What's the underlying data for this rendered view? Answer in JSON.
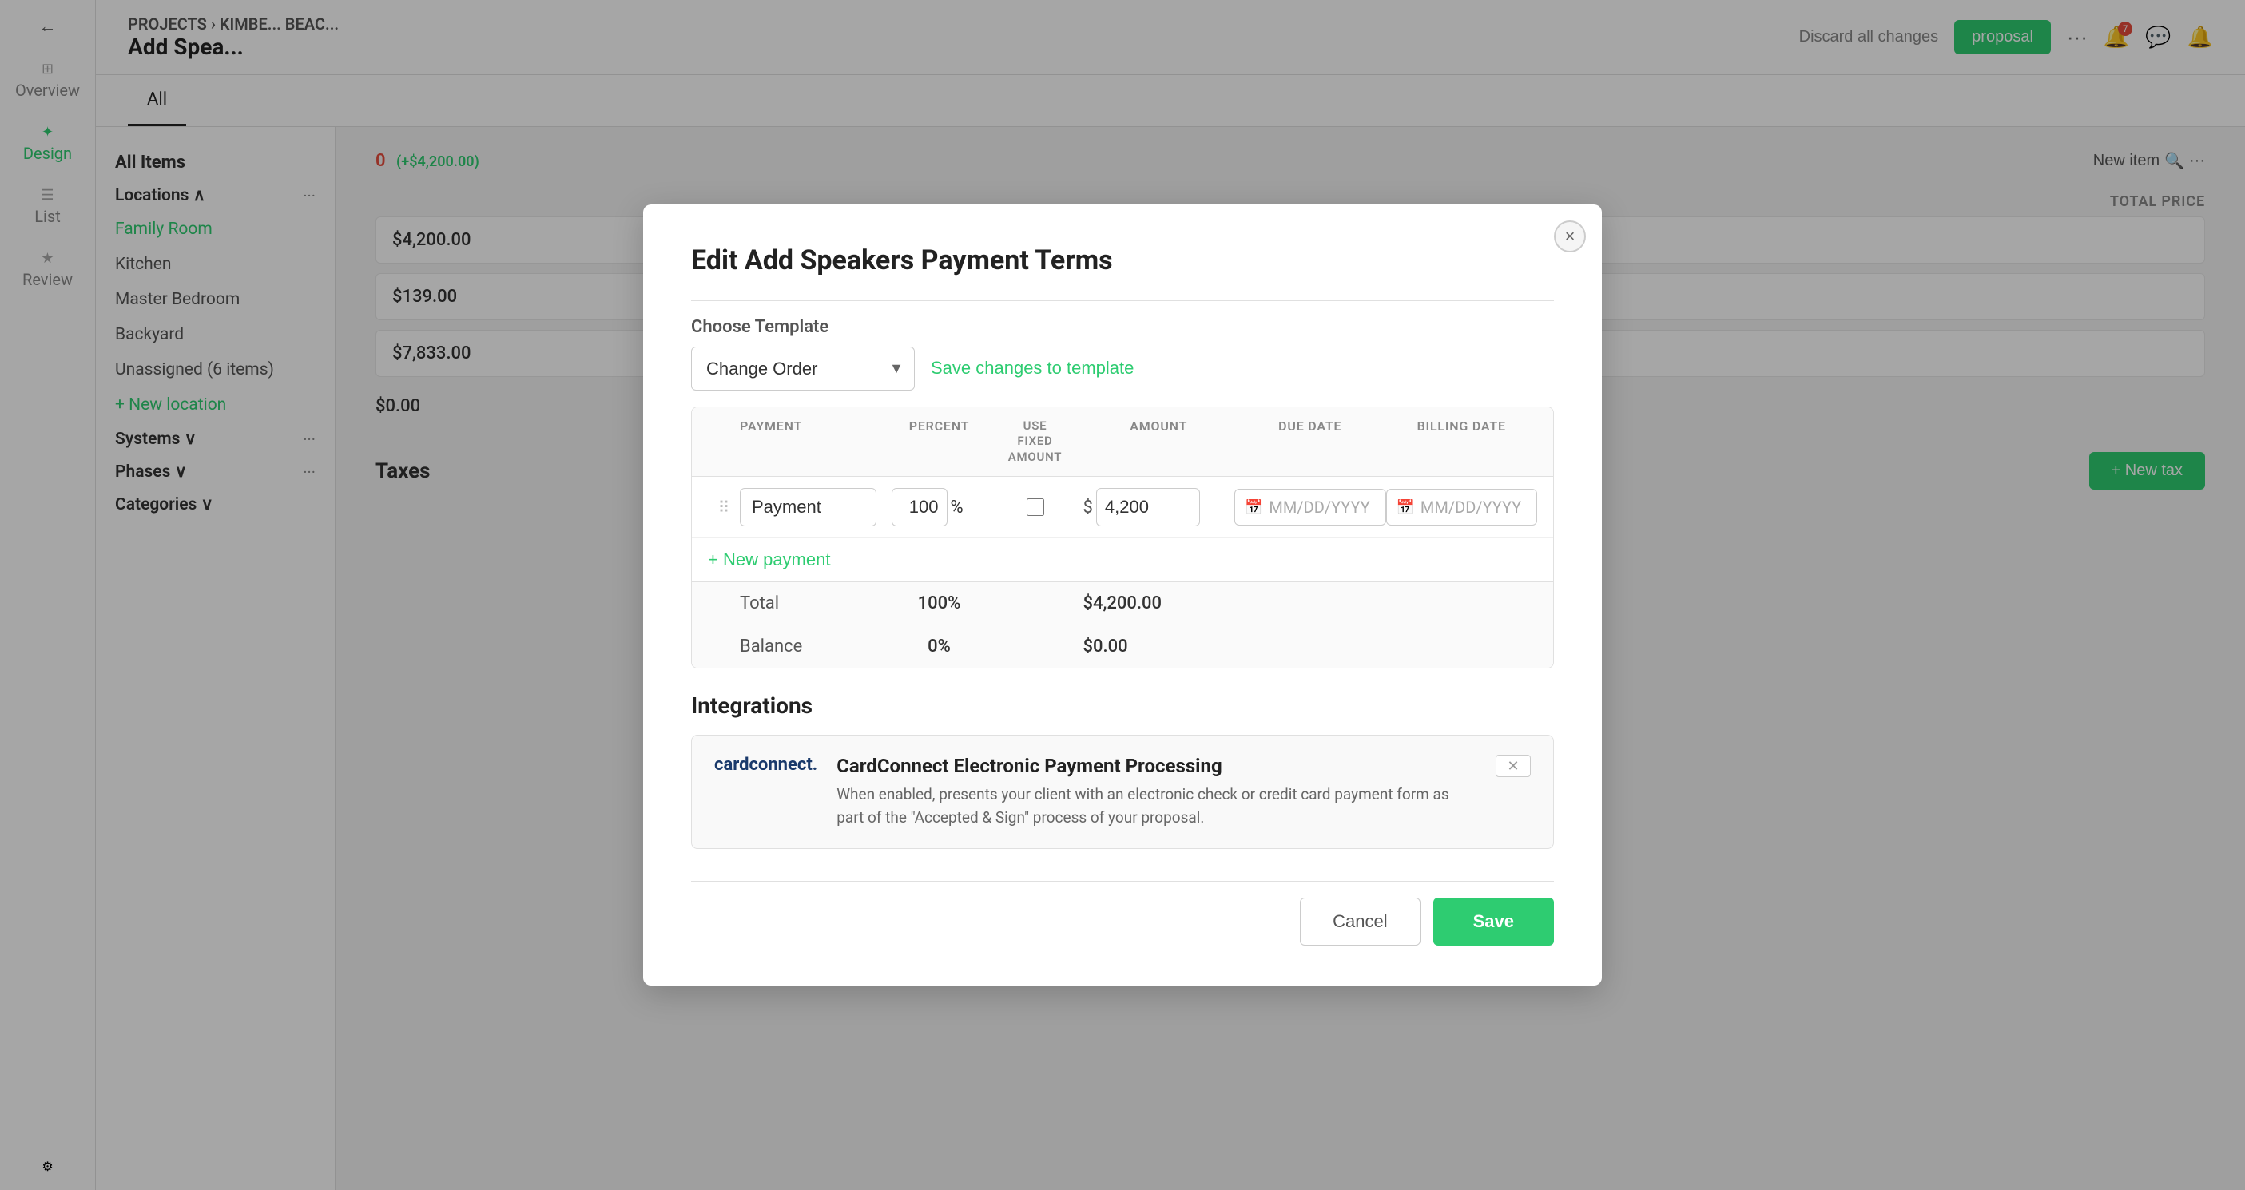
{
  "app": {
    "breadcrumb": "PROJECTS › KIMBE... BEAC...",
    "page_title": "Add Spea...",
    "back_label": "←"
  },
  "topbar": {
    "proposal_btn": "proposal",
    "more_btn": "···",
    "discard_label": "Discard all changes",
    "notification_count": "7"
  },
  "subnav": {
    "tabs": [
      {
        "label": "All",
        "active": true
      }
    ]
  },
  "sidebar": {
    "items": [
      {
        "label": "Overview",
        "icon": "⊞",
        "active": false
      },
      {
        "label": "Design",
        "icon": "✦",
        "active": true
      },
      {
        "label": "List",
        "icon": "☰",
        "active": false
      },
      {
        "label": "Review",
        "icon": "★",
        "active": false
      }
    ],
    "settings_icon": "⚙"
  },
  "left_panel": {
    "all_items": "All Items",
    "sections": [
      {
        "title": "Locations",
        "items": [
          "Family Room",
          "Kitchen",
          "Master Bedroom",
          "Backyard",
          "Unassigned (6 items)"
        ],
        "active_item": "Family Room"
      },
      {
        "title": "Systems"
      },
      {
        "title": "Phases"
      },
      {
        "title": "Categories"
      }
    ],
    "new_location": "+ New location"
  },
  "right_panel": {
    "price_display": "0  (+$4,200.00)",
    "table_header": "TOTAL PRICE",
    "new_item_label": "New item",
    "rows": [
      {
        "price": "$4,200.00"
      },
      {
        "price": "$139.00"
      },
      {
        "price": "$7,833.00"
      }
    ],
    "balance_value": "$0.00",
    "taxes_title": "Taxes",
    "new_tax_btn": "+ New tax"
  },
  "modal": {
    "title": "Edit Add Speakers Payment Terms",
    "close_label": "×",
    "choose_template_label": "Choose Template",
    "template_value": "Change Order",
    "save_template_label": "Save changes to template",
    "table": {
      "columns": [
        {
          "label": ""
        },
        {
          "label": "PAYMENT"
        },
        {
          "label": "PERCENT"
        },
        {
          "label": "USE\nFIXED\nAMOUNT"
        },
        {
          "label": "AMOUNT"
        },
        {
          "label": "DUE DATE"
        },
        {
          "label": "BILLING DATE"
        }
      ],
      "rows": [
        {
          "name": "Payment",
          "percent": "100",
          "fixed": false,
          "amount": "4,200",
          "due_date": "MM/DD/YYYY",
          "billing_date": "MM/DD/YYYY"
        }
      ],
      "new_payment_label": "+ New payment",
      "footer": [
        {
          "label": "Total",
          "percent": "100%",
          "amount": "$4,200.00"
        },
        {
          "label": "Balance",
          "percent": "0%",
          "amount": "$0.00"
        }
      ]
    },
    "integrations": {
      "title": "Integrations",
      "card": {
        "logo": "cardconnect.",
        "title": "CardConnect Electronic Payment Processing",
        "description": "When enabled, presents your client with an electronic check or credit card payment form as part of the \"Accepted & Sign\" process of your proposal."
      }
    },
    "cancel_label": "Cancel",
    "save_label": "Save"
  }
}
